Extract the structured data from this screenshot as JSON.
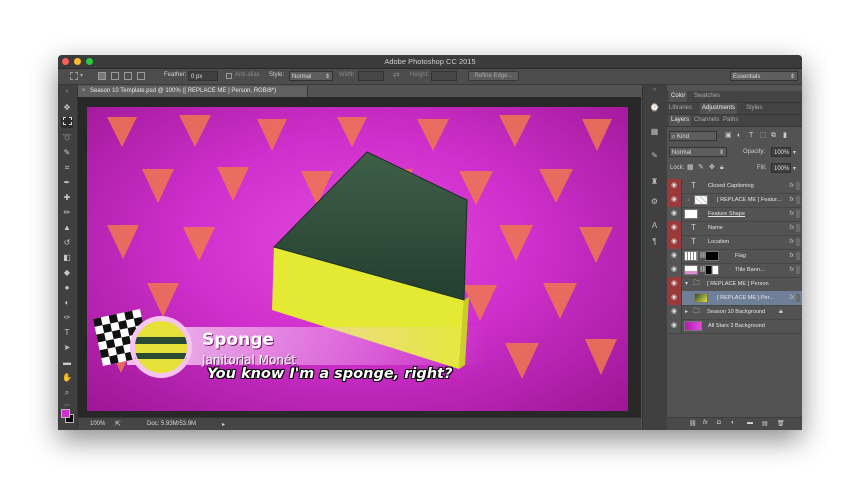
{
  "app": {
    "title": "Adobe Photoshop CC 2015"
  },
  "colors": {
    "red": "#fc5f57",
    "yellow": "#fdbd2e",
    "green": "#28c840",
    "foreground": "#d02fd0",
    "background": "#000000"
  },
  "options_bar": {
    "feather_label": "Feather:",
    "feather_value": "0 px",
    "antialias_label": "Anti-alias",
    "style_label": "Style:",
    "style_value": "Normal",
    "width_label": "Width:",
    "height_label": "Height:",
    "refine_edge_label": "Refine Edge...",
    "workspace_value": "Essentials"
  },
  "document": {
    "tab_label": "Season 10 Template.psd @ 100% ([ REPLACE ME ] Person, RGB/8*)",
    "zoom": "100%",
    "doc_size": "Doc: 5.93M/53.9M"
  },
  "canvas_text": {
    "name": "Sponge",
    "location": "Janitorial Monét",
    "caption": "You know I'm a sponge, right?"
  },
  "panels": {
    "color_tabs": [
      "Color",
      "Swatches"
    ],
    "adj_tabs": [
      "Libraries",
      "Adjustments",
      "Styles"
    ],
    "layer_tabs": [
      "Layers",
      "Channels",
      "Paths"
    ],
    "kind_label": "Kind",
    "blend_mode": "Normal",
    "opacity_label": "Opacity:",
    "opacity_value": "100%",
    "lock_label": "Lock:",
    "fill_label": "Fill:",
    "fill_value": "100%"
  },
  "layers": [
    {
      "name": "Closed Captioning",
      "type": "text",
      "fx": true,
      "red": true
    },
    {
      "name": "[ REPLACE ME ] Featur...",
      "type": "smart",
      "fx": true,
      "red": true
    },
    {
      "name": "Feature Shape",
      "type": "shape",
      "fx": true,
      "red": false
    },
    {
      "name": "Name",
      "type": "text",
      "fx": true,
      "red": true
    },
    {
      "name": "Location",
      "type": "text",
      "fx": true,
      "red": true
    },
    {
      "name": "Flag",
      "type": "masked",
      "fx": true,
      "red": false
    },
    {
      "name": "Title Bann...",
      "type": "masked",
      "fx": true,
      "red": false
    },
    {
      "name": "[ REPLACE ME ] Person",
      "type": "group-open",
      "fx": false,
      "red": true
    },
    {
      "name": "[ REPLACE ME ] Per...",
      "type": "selected",
      "fx": true,
      "red": true
    },
    {
      "name": "Season 10 Background",
      "type": "group",
      "fx": false,
      "red": false
    },
    {
      "name": "All Stars 3 Background",
      "type": "image",
      "fx": false,
      "red": false
    }
  ]
}
